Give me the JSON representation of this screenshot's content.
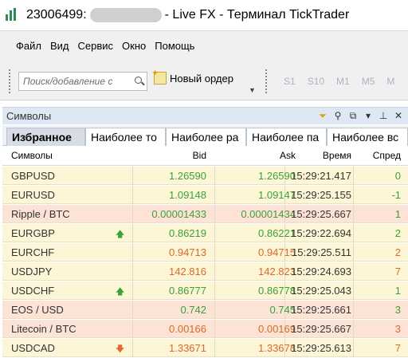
{
  "window": {
    "account_id": "23006499:",
    "title_suffix": "- Live FX - Терминал TickTrader"
  },
  "menu": [
    "Файл",
    "Вид",
    "Сервис",
    "Окно",
    "Помощь"
  ],
  "toolbar": {
    "search_placeholder": "Поиск/добавление с",
    "new_order_label": "Новый ордер",
    "timeframes": [
      "S1",
      "S10",
      "M1",
      "M5",
      "M"
    ]
  },
  "panel": {
    "title": "Символы",
    "tabs": [
      "Избранное",
      "Наиболее то",
      "Наиболее ра",
      "Наиболее па",
      "Наиболее вс"
    ],
    "active_tab": 0
  },
  "grid": {
    "columns": {
      "symbol": "Символы",
      "bid": "Bid",
      "ask": "Ask",
      "time": "Время",
      "spread": "Спред"
    },
    "rows": [
      {
        "symbol": "GBPUSD",
        "bid": "1.26590",
        "ask": "1.26590",
        "time": "15:29:21.417",
        "spread": "0",
        "bg": "yellow",
        "bid_color": "#3aa23a",
        "ask_color": "#3aa23a",
        "spread_color": "#3aa23a",
        "arrow": ""
      },
      {
        "symbol": "EURUSD",
        "bid": "1.09148",
        "ask": "1.09147",
        "time": "15:29:25.155",
        "spread": "-1",
        "bg": "yellow",
        "bid_color": "#3aa23a",
        "ask_color": "#3aa23a",
        "spread_color": "#3aa23a",
        "arrow": ""
      },
      {
        "symbol": "Ripple / BTC",
        "bid": "0.00001433",
        "ask": "0.00001434",
        "time": "15:29:25.667",
        "spread": "1",
        "bg": "pink",
        "bid_color": "#3aa23a",
        "ask_color": "#3aa23a",
        "spread_color": "#3aa23a",
        "arrow": ""
      },
      {
        "symbol": "EURGBP",
        "bid": "0.86219",
        "ask": "0.86221",
        "time": "15:29:22.694",
        "spread": "2",
        "bg": "yellow",
        "bid_color": "#3aa23a",
        "ask_color": "#3aa23a",
        "spread_color": "#3aa23a",
        "arrow": "up"
      },
      {
        "symbol": "EURCHF",
        "bid": "0.94713",
        "ask": "0.94715",
        "time": "15:29:25.511",
        "spread": "2",
        "bg": "yellow",
        "bid_color": "#d86a2a",
        "ask_color": "#d86a2a",
        "spread_color": "#d86a2a",
        "arrow": ""
      },
      {
        "symbol": "USDJPY",
        "bid": "142.816",
        "ask": "142.823",
        "time": "15:29:24.693",
        "spread": "7",
        "bg": "yellow",
        "bid_color": "#d86a2a",
        "ask_color": "#d86a2a",
        "spread_color": "#d86a2a",
        "arrow": ""
      },
      {
        "symbol": "USDCHF",
        "bid": "0.86777",
        "ask": "0.86778",
        "time": "15:29:25.043",
        "spread": "1",
        "bg": "yellow",
        "bid_color": "#3aa23a",
        "ask_color": "#3aa23a",
        "spread_color": "#3aa23a",
        "arrow": "up"
      },
      {
        "symbol": "EOS / USD",
        "bid": "0.742",
        "ask": "0.745",
        "time": "15:29:25.661",
        "spread": "3",
        "bg": "pink",
        "bid_color": "#3aa23a",
        "ask_color": "#3aa23a",
        "spread_color": "#3aa23a",
        "arrow": ""
      },
      {
        "symbol": "Litecoin / BTC",
        "bid": "0.00166",
        "ask": "0.00169",
        "time": "15:29:25.667",
        "spread": "3",
        "bg": "pink",
        "bid_color": "#d86a2a",
        "ask_color": "#d86a2a",
        "spread_color": "#d86a2a",
        "arrow": ""
      },
      {
        "symbol": "USDCAD",
        "bid": "1.33671",
        "ask": "1.33678",
        "time": "15:29:25.613",
        "spread": "7",
        "bg": "yellow",
        "bid_color": "#d86a2a",
        "ask_color": "#d86a2a",
        "spread_color": "#d86a2a",
        "arrow": "down"
      }
    ]
  }
}
